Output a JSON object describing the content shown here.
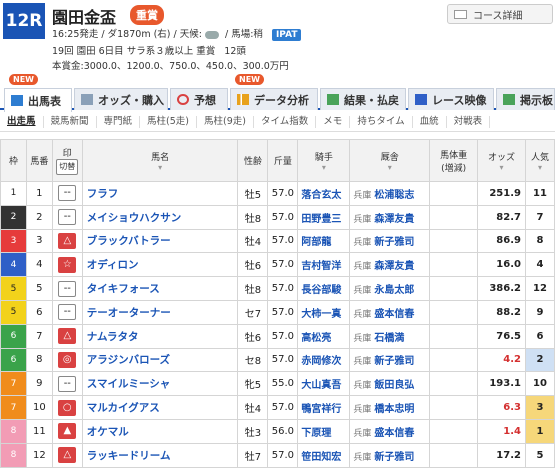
{
  "header": {
    "race_number": "12R",
    "race_name": "園田金盃",
    "grade": "重賞",
    "course_button": "コース詳細",
    "start_time": "16:25発走",
    "course": "/ ダ1870m (右)",
    "weather_label": "/ 天候:",
    "track": "/ 馬場:稍",
    "ipat": "IPAT",
    "info_line": "19回 園田 6日目 サラ系３歳以上 重賞",
    "field_size": "12頭",
    "prize": "本賞金:3000.0、1200.0、750.0、450.0、300.0万円"
  },
  "tabs": [
    {
      "label": "出馬表",
      "new": true
    },
    {
      "label": "オッズ・購入",
      "new": false
    },
    {
      "label": "予想",
      "new": false
    },
    {
      "label": "データ分析",
      "new": true
    },
    {
      "label": "結果・払戻",
      "new": false
    },
    {
      "label": "レース映像",
      "new": false
    },
    {
      "label": "掲示板",
      "new": false
    }
  ],
  "new_label": "NEW",
  "subnav": [
    "出走馬",
    "競馬新聞",
    "専門紙",
    "馬柱(5走)",
    "馬柱(9走)",
    "タイム指数",
    "メモ",
    "持ちタイム",
    "血統",
    "対戦表"
  ],
  "columns": {
    "waku": "枠",
    "umaban": "馬番",
    "mark": "印",
    "mark_sub": "切替",
    "horse": "馬名",
    "sex_age": "性齢",
    "weight": "斤量",
    "jockey": "騎手",
    "trainer": "厩舎",
    "body_weight": "馬体重",
    "body_weight_sub": "(増減)",
    "odds": "オッズ",
    "popularity": "人気"
  },
  "rows": [
    {
      "waku": "1",
      "umaban": "1",
      "mark": "--",
      "horse": "フラフ",
      "sex_age": "牡5",
      "weight": "57.0",
      "jockey": "落合玄太",
      "area": "兵庫",
      "trainer": "松浦聡志",
      "odds": "251.9",
      "pop": "11"
    },
    {
      "waku": "2",
      "umaban": "2",
      "mark": "--",
      "horse": "メイショウハクサン",
      "sex_age": "牡8",
      "weight": "57.0",
      "jockey": "田野豊三",
      "area": "兵庫",
      "trainer": "森澤友貴",
      "odds": "82.7",
      "pop": "7"
    },
    {
      "waku": "3",
      "umaban": "3",
      "mark": "△",
      "horse": "ブラックバトラー",
      "sex_age": "牡4",
      "weight": "57.0",
      "jockey": "阿部龍",
      "area": "兵庫",
      "trainer": "新子雅司",
      "odds": "86.9",
      "pop": "8"
    },
    {
      "waku": "4",
      "umaban": "4",
      "mark": "☆",
      "horse": "オディロン",
      "sex_age": "牡6",
      "weight": "57.0",
      "jockey": "吉村智洋",
      "area": "兵庫",
      "trainer": "森澤友貴",
      "odds": "16.0",
      "pop": "4"
    },
    {
      "waku": "5",
      "umaban": "5",
      "mark": "--",
      "horse": "タイキフォース",
      "sex_age": "牡8",
      "weight": "57.0",
      "jockey": "長谷部駿",
      "area": "兵庫",
      "trainer": "永島太郎",
      "odds": "386.2",
      "pop": "12"
    },
    {
      "waku": "5",
      "umaban": "6",
      "mark": "--",
      "horse": "テーオーターナー",
      "sex_age": "セ7",
      "weight": "57.0",
      "jockey": "大柿一真",
      "area": "兵庫",
      "trainer": "盛本信春",
      "odds": "88.2",
      "pop": "9"
    },
    {
      "waku": "6",
      "umaban": "7",
      "mark": "△",
      "horse": "ナムラタタ",
      "sex_age": "牡6",
      "weight": "57.0",
      "jockey": "高松亮",
      "area": "兵庫",
      "trainer": "石橋満",
      "odds": "76.5",
      "pop": "6"
    },
    {
      "waku": "6",
      "umaban": "8",
      "mark": "◎",
      "horse": "アラジンバローズ",
      "sex_age": "セ8",
      "weight": "57.0",
      "jockey": "赤岡修次",
      "area": "兵庫",
      "trainer": "新子雅司",
      "odds": "4.2",
      "pop": "2"
    },
    {
      "waku": "7",
      "umaban": "9",
      "mark": "--",
      "horse": "スマイルミーシャ",
      "sex_age": "牝5",
      "weight": "55.0",
      "jockey": "大山真吾",
      "area": "兵庫",
      "trainer": "飯田良弘",
      "odds": "193.1",
      "pop": "10"
    },
    {
      "waku": "7",
      "umaban": "10",
      "mark": "○",
      "horse": "マルカイグアス",
      "sex_age": "牡4",
      "weight": "57.0",
      "jockey": "鴨宮祥行",
      "area": "兵庫",
      "trainer": "橋本忠明",
      "odds": "6.3",
      "pop": "3"
    },
    {
      "waku": "8",
      "umaban": "11",
      "mark": "▲",
      "horse": "オケマル",
      "sex_age": "牡3",
      "weight": "56.0",
      "jockey": "下原理",
      "area": "兵庫",
      "trainer": "盛本信春",
      "odds": "1.4",
      "pop": "1"
    },
    {
      "waku": "8",
      "umaban": "12",
      "mark": "△",
      "horse": "ラッキードリーム",
      "sex_age": "牡7",
      "weight": "57.0",
      "jockey": "笹田知宏",
      "area": "兵庫",
      "trainer": "新子雅司",
      "odds": "17.2",
      "pop": "5"
    }
  ],
  "colors": {
    "accent": "#1a54b5",
    "grade": "#e8582c",
    "waku": {
      "1": "#ffffff",
      "2": "#333333",
      "3": "#e63b3b",
      "4": "#2f5fc7",
      "5": "#f2d21b",
      "6": "#3aa34a",
      "7": "#f08c1c",
      "8": "#f29cb5"
    },
    "pop_top": "#f6d77a",
    "pop_second": "#cfe0f4",
    "odds_low": "#d43030"
  }
}
